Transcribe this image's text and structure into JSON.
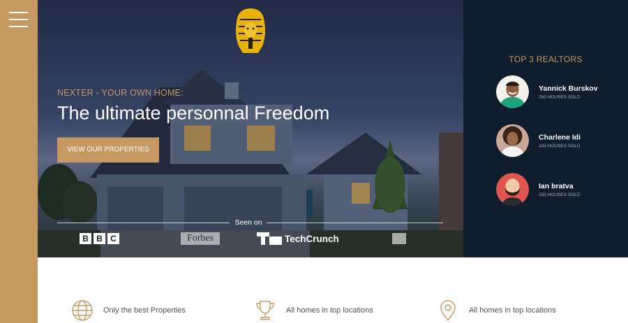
{
  "menu": {
    "icon": "hamburger-menu-icon"
  },
  "hero": {
    "logo_icon": "pharaoh-logo-icon",
    "subtitle": "NEXTER - YOUR OWN HOME:",
    "title": "The ultimate personnal Freedom",
    "cta_label": "VIEW OUR PROPERTIES",
    "seen_on_label": "Seen on",
    "press": {
      "bbc": [
        "B",
        "B",
        "C"
      ],
      "forbes": "Forbes",
      "techcrunch": "TechCrunch"
    }
  },
  "realtors": {
    "title": "TOP 3 REALTORS",
    "items": [
      {
        "name": "Yannick Burskov",
        "sold": "250 HOUSES SOLD",
        "avatar_color": "#f3f1ec"
      },
      {
        "name": "Charlene Idi",
        "sold": "243 HOUSES SOLD",
        "avatar_color": "#c8a89a"
      },
      {
        "name": "Ian bratva",
        "sold": "232 HOUSES SOLD",
        "avatar_color": "#e0554f"
      }
    ]
  },
  "features": [
    {
      "icon": "globe-icon",
      "label": "Only the best Properties"
    },
    {
      "icon": "trophy-icon",
      "label": "All homes in top locations"
    },
    {
      "icon": "map-pin-icon",
      "label": "All homes in top locations"
    }
  ],
  "colors": {
    "accent": "#c69963",
    "dark": "#101d2c",
    "white": "#ffffff"
  }
}
